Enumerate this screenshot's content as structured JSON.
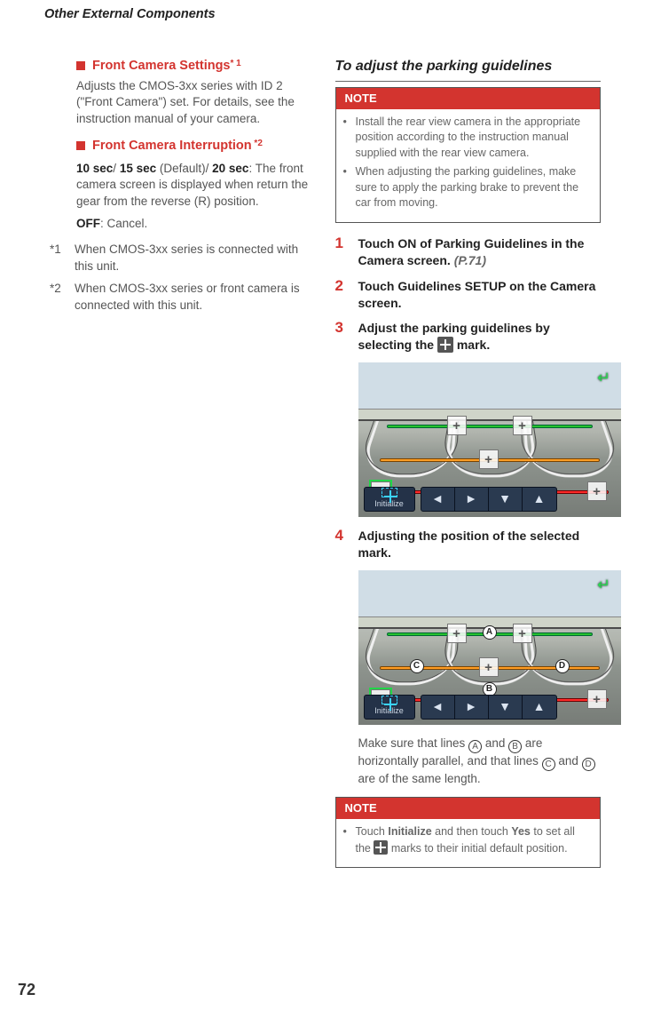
{
  "header": {
    "title": "Other External Components"
  },
  "left": {
    "sub1": {
      "title": "Front Camera Settings",
      "sup": "* 1",
      "body": "Adjusts the CMOS-3xx series with ID 2 (\"Front Camera\") set. For details, see the instruction manual of your camera."
    },
    "sub2": {
      "title": "Front Camera Interruption",
      "sup": " *2",
      "opt1_a": "10 sec",
      "slash1": "/ ",
      "opt1_b": "15 sec",
      "def": " (Default)/ ",
      "opt1_c": "20 sec",
      "body2": ": The front camera screen is displayed when return the gear from the reverse (R) position.",
      "opt2": "OFF",
      "body3": ": Cancel."
    },
    "fn1": {
      "num": "*1",
      "text": "When CMOS-3xx series is connected with this unit."
    },
    "fn2": {
      "num": "*2",
      "text": "When CMOS-3xx series or front camera is connected with this unit."
    }
  },
  "right": {
    "sectionTitle": "To adjust the parking guidelines",
    "note1": {
      "head": "NOTE",
      "i1": "Install the rear view camera in the appropriate position according to the instruction manual supplied with the rear view camera.",
      "i2": "When adjusting the parking guidelines, make sure to apply the parking brake to prevent the car from moving."
    },
    "step1": {
      "n": "1",
      "a": "Touch ",
      "on": "ON",
      "b": " of ",
      "pg": "Parking Guidelines",
      "c": " in the Camera screen. ",
      "ref": "(P.71)"
    },
    "step2": {
      "n": "2",
      "a": "Touch ",
      "gs": "Guidelines SETUP",
      "b": " on the Camera screen."
    },
    "step3": {
      "n": "3",
      "a": "Adjust the parking guidelines by selecting the ",
      "b": " mark."
    },
    "step4": {
      "n": "4",
      "a": "Adjusting the position of the selected mark."
    },
    "afterCam": {
      "a": "Make sure that lines ",
      "A": "A",
      "b": " and ",
      "B": "B",
      "c": " are horizontally parallel, and that lines ",
      "C": "C",
      "d": " and ",
      "D": "D",
      "e": " are of the same length."
    },
    "note2": {
      "head": "NOTE",
      "a": "Touch ",
      "init": "Initialize",
      "b": " and then touch ",
      "yes": "Yes",
      "c": " to set all the ",
      "d": " marks to their initial default position."
    }
  },
  "cam": {
    "initialize": "Initialize",
    "labels": {
      "A": "A",
      "B": "B",
      "C": "C",
      "D": "D"
    }
  },
  "pageNumber": "72"
}
